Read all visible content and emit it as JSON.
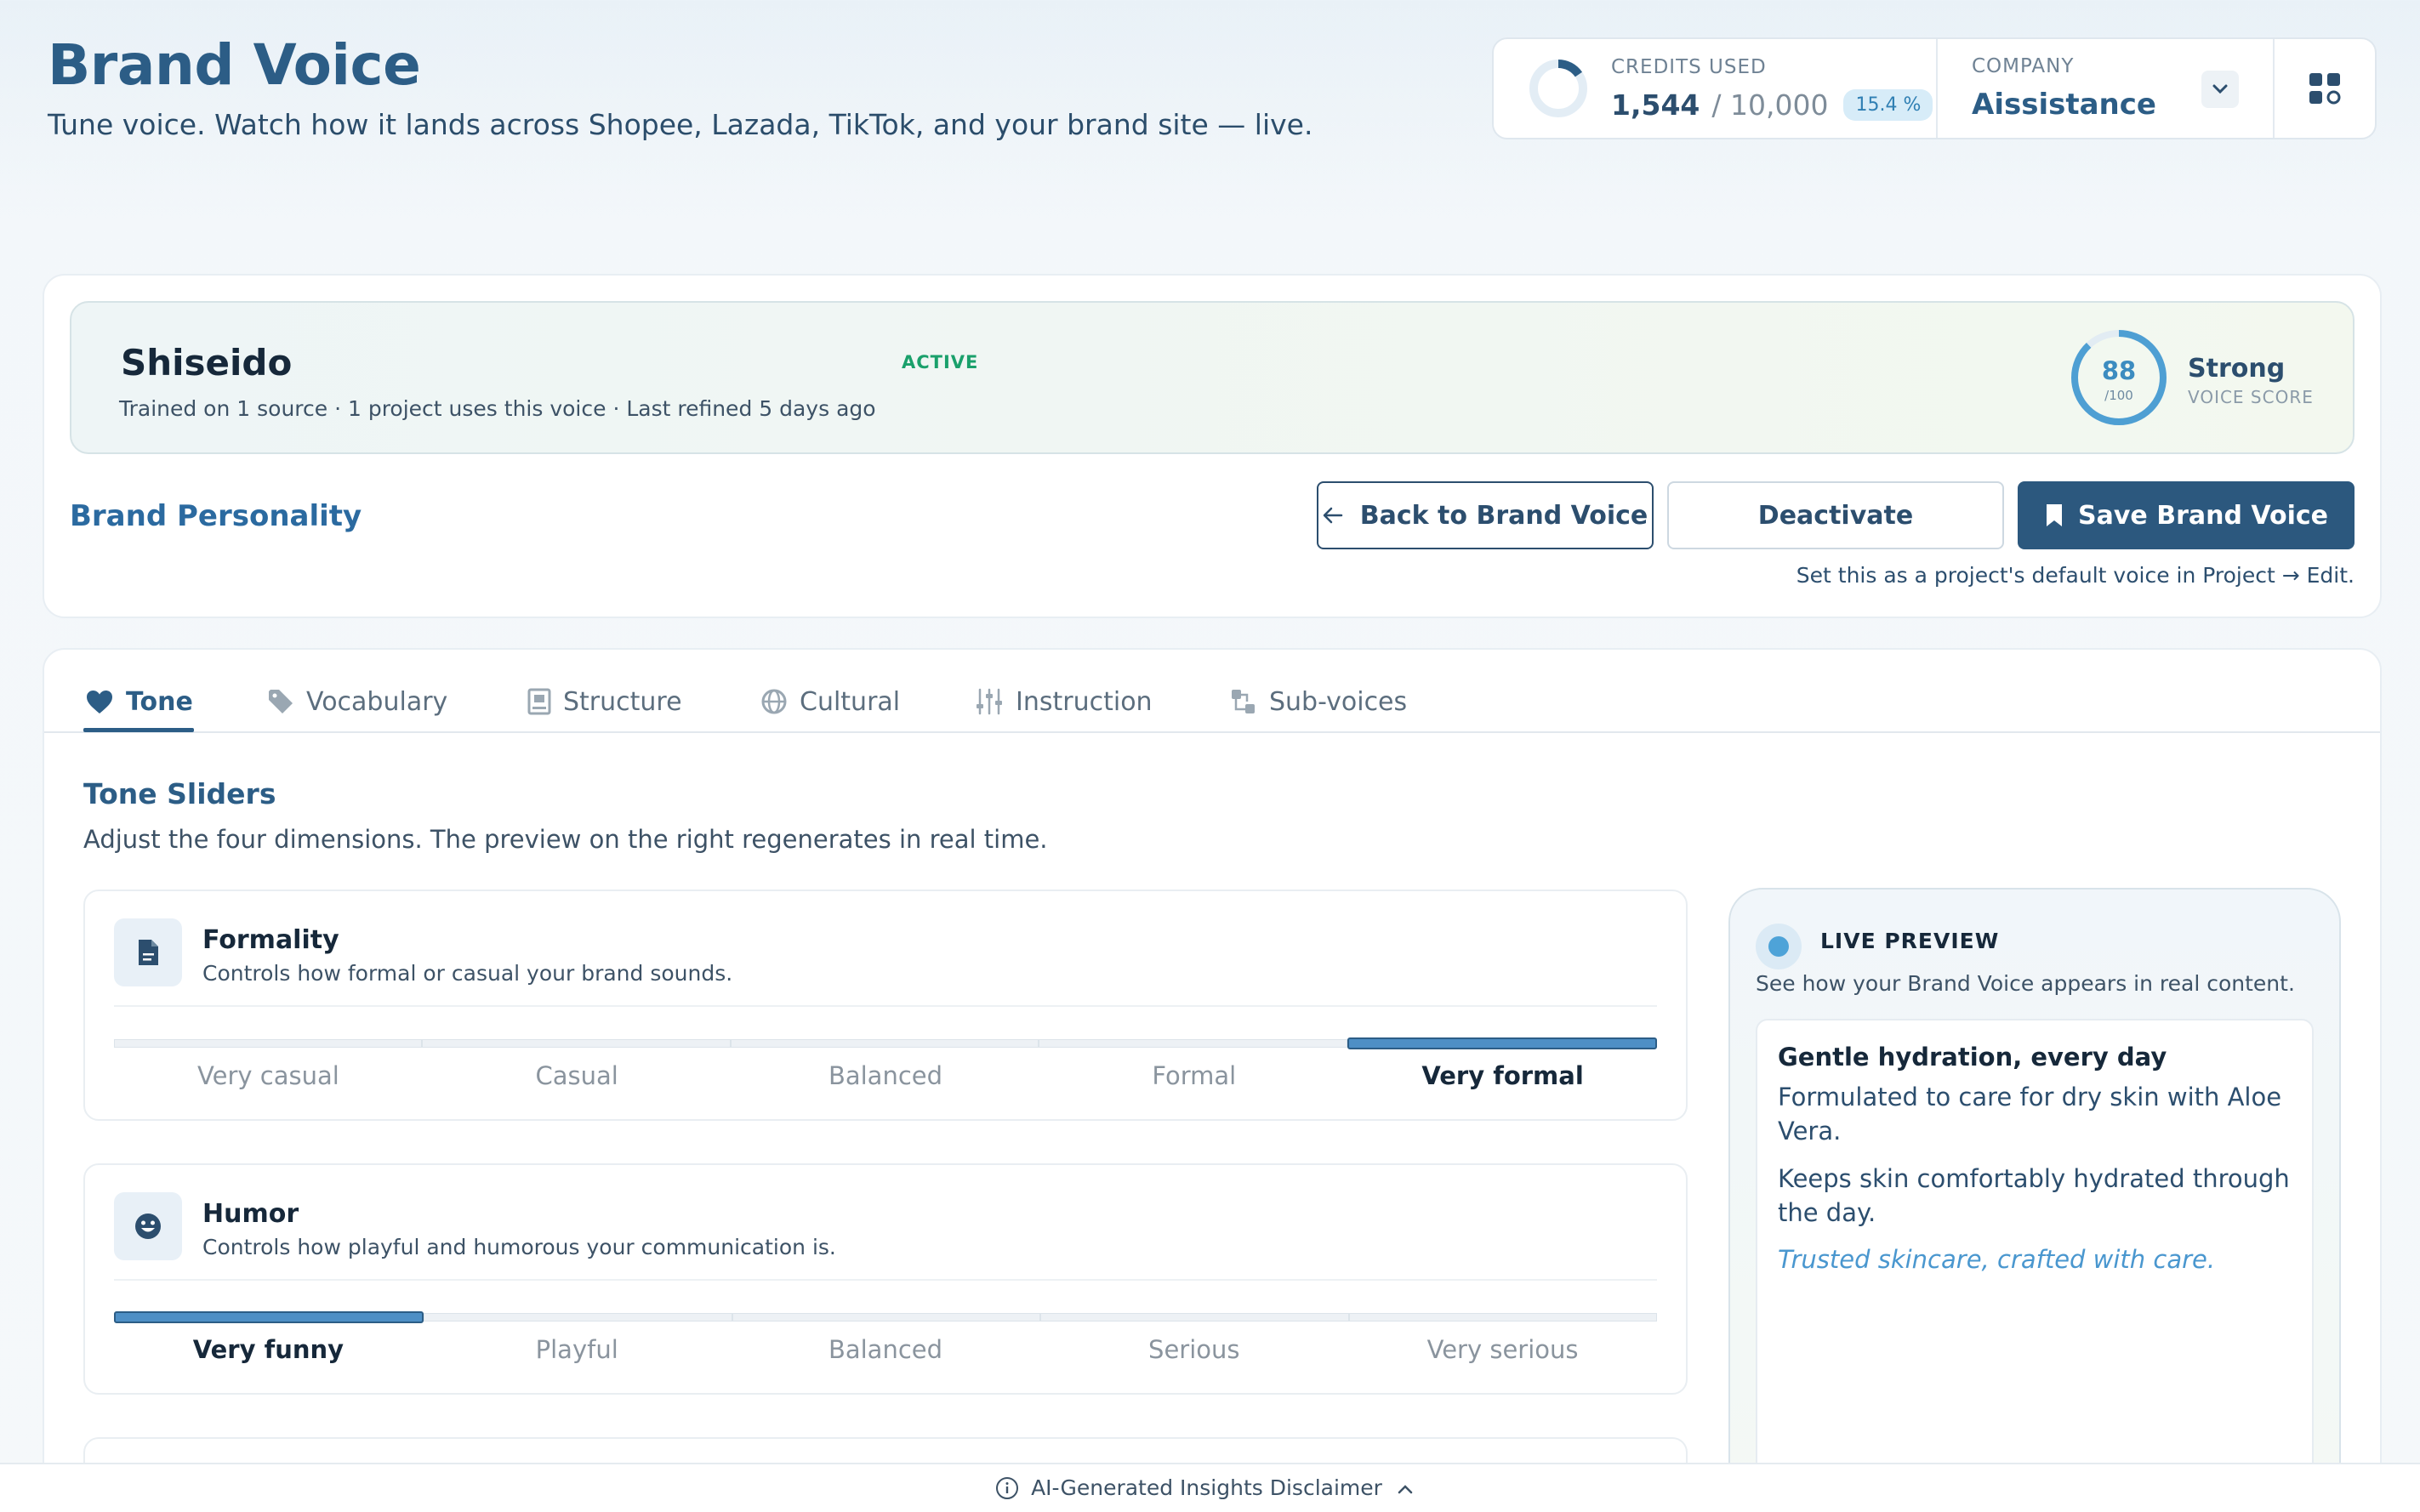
{
  "header": {
    "title": "Brand Voice",
    "subtitle": "Tune voice. Watch how it lands across Shopee, Lazada, TikTok, and your brand site — live."
  },
  "credits": {
    "label": "CREDITS USED",
    "used": "1,544",
    "total": "/ 10,000",
    "percent": "15.4 %",
    "fraction_used": 0.154
  },
  "company": {
    "label": "COMPANY",
    "name": "Aissistance"
  },
  "voice": {
    "name": "Shiseido",
    "status": "ACTIVE",
    "meta": "Trained on 1 source · 1 project uses this voice · Last refined 5 days ago",
    "score": "88",
    "score_max": "/100",
    "score_fraction": 0.88,
    "score_label": "Strong",
    "score_caption": "VOICE SCORE"
  },
  "personality": {
    "title": "Brand Personality",
    "back_label": "Back to Brand Voice",
    "deactivate_label": "Deactivate",
    "save_label": "Save Brand Voice",
    "hint": "Set this as a project's default voice in Project → Edit."
  },
  "tabs": [
    {
      "label": "Tone",
      "icon": "heart-icon",
      "active": true
    },
    {
      "label": "Vocabulary",
      "icon": "tag-icon",
      "active": false
    },
    {
      "label": "Structure",
      "icon": "structure-icon",
      "active": false
    },
    {
      "label": "Cultural",
      "icon": "globe-icon",
      "active": false
    },
    {
      "label": "Instruction",
      "icon": "sliders-icon",
      "active": false
    },
    {
      "label": "Sub-voices",
      "icon": "sub-voices-icon",
      "active": false
    }
  ],
  "tone_section": {
    "title": "Tone Sliders",
    "subtitle": "Adjust the four dimensions. The preview on the right regenerates in real time."
  },
  "sliders": [
    {
      "title": "Formality",
      "description": "Controls how formal or casual your brand sounds.",
      "icon": "document-icon",
      "options": [
        "Very casual",
        "Casual",
        "Balanced",
        "Formal",
        "Very formal"
      ],
      "selected_index": 4
    },
    {
      "title": "Humor",
      "description": "Controls how playful and humorous your communication is.",
      "icon": "smiley-icon",
      "options": [
        "Very funny",
        "Playful",
        "Balanced",
        "Serious",
        "Very serious"
      ],
      "selected_index": 0
    }
  ],
  "preview": {
    "label": "LIVE PREVIEW",
    "subtitle": "See how your Brand Voice appears in real content.",
    "headline": "Gentle hydration, every day",
    "body_1": "Formulated to care for dry skin with Aloe Vera.",
    "body_2": "Keeps skin comfortably hydrated through the day.",
    "tagline": "Trusted skincare, crafted with care."
  },
  "footer": {
    "disclaimer": "AI-Generated Insights Disclaimer"
  },
  "colors": {
    "brand": "#2c5d86",
    "accent": "#4e8fc5",
    "active_green": "#1aa06b",
    "save_button": "#2c587e"
  }
}
